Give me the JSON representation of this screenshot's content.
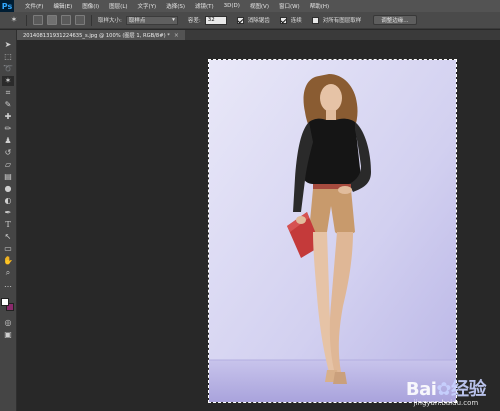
{
  "app": {
    "logo": "Ps"
  },
  "menu": [
    "文件(F)",
    "编辑(E)",
    "图像(I)",
    "图层(L)",
    "文字(Y)",
    "选择(S)",
    "滤镜(T)",
    "3D(D)",
    "视图(V)",
    "窗口(W)",
    "帮助(H)"
  ],
  "options": {
    "sample_size_label": "取样大小:",
    "sample_size_value": "取样点",
    "tolerance_label": "容差:",
    "tolerance_value": "32",
    "antialias_label": "消除锯齿",
    "antialias_checked": true,
    "contiguous_label": "连续",
    "contiguous_checked": true,
    "sample_all_layers_label": "对所有图层取样",
    "sample_all_layers_checked": false,
    "refine_edge_label": "调整边缘..."
  },
  "document": {
    "tab_title": "201408131931224635_s.jpg @ 100% (图层 1, RGB/8#) *",
    "close_symbol": "×"
  },
  "colors": {
    "foreground": "#ffffff",
    "background": "#8a2a6c"
  },
  "watermark": {
    "logo_left": "Bai",
    "logo_right": "经验",
    "url": "jingyan.baidu.com"
  }
}
